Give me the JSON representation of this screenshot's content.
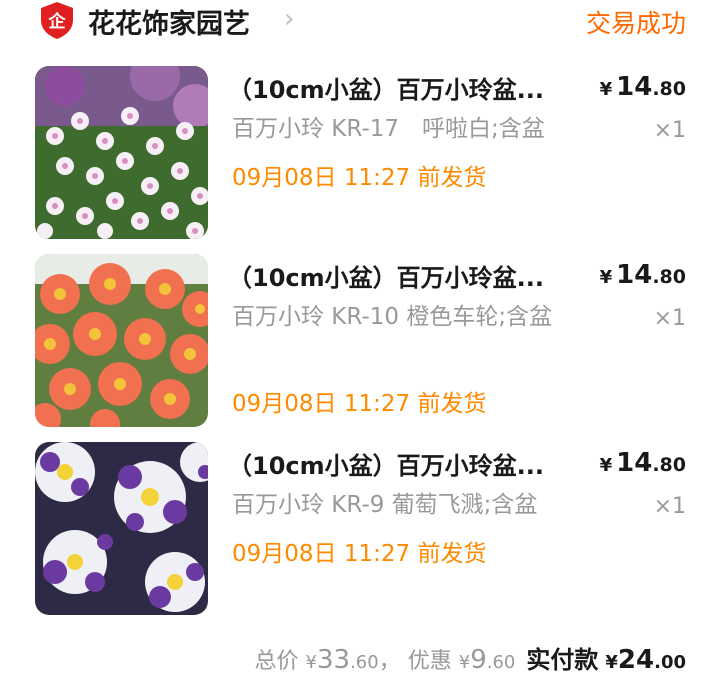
{
  "shop": {
    "badge": "企",
    "name": "花花饰家园艺",
    "arrow": "›",
    "status": "交易成功",
    "brand_color": "#e02020",
    "status_color": "#ff6a00"
  },
  "items": [
    {
      "title": "（10cm小盆）百万小玲盆...",
      "price_symbol": "¥",
      "price_int": "14",
      "price_dec": ".80",
      "sku": "百万小玲 KR-17　呼啦白;含盆",
      "qty": "×1",
      "ship": "09月08日 11:27 前发货",
      "image": "white-pink-calibrachoa-photo"
    },
    {
      "title": "（10cm小盆）百万小玲盆...",
      "price_symbol": "¥",
      "price_int": "14",
      "price_dec": ".80",
      "sku": "百万小玲 KR-10 橙色车轮;含盆",
      "qty": "×1",
      "ship": "09月08日 11:27 前发货",
      "image": "orange-calibrachoa-photo"
    },
    {
      "title": "（10cm小盆）百万小玲盆...",
      "price_symbol": "¥",
      "price_int": "14",
      "price_dec": ".80",
      "sku": "百万小玲 KR-9 葡萄飞溅;含盆",
      "qty": "×1",
      "ship": "09月08日 11:27 前发货",
      "image": "purple-splash-calibrachoa-photo"
    }
  ],
  "summary": {
    "total_label": "总价",
    "total_symbol": "¥",
    "total_int": "33",
    "total_dec": ".60",
    "separator": "，",
    "discount_label": "优惠",
    "discount_symbol": "¥",
    "discount_int": "9",
    "discount_dec": ".60",
    "paid_label": "实付款",
    "paid_symbol": "¥",
    "paid_int": "24",
    "paid_dec": ".00"
  },
  "colors": {
    "ship_orange": "#ff8a00",
    "muted_gray": "#999999"
  }
}
